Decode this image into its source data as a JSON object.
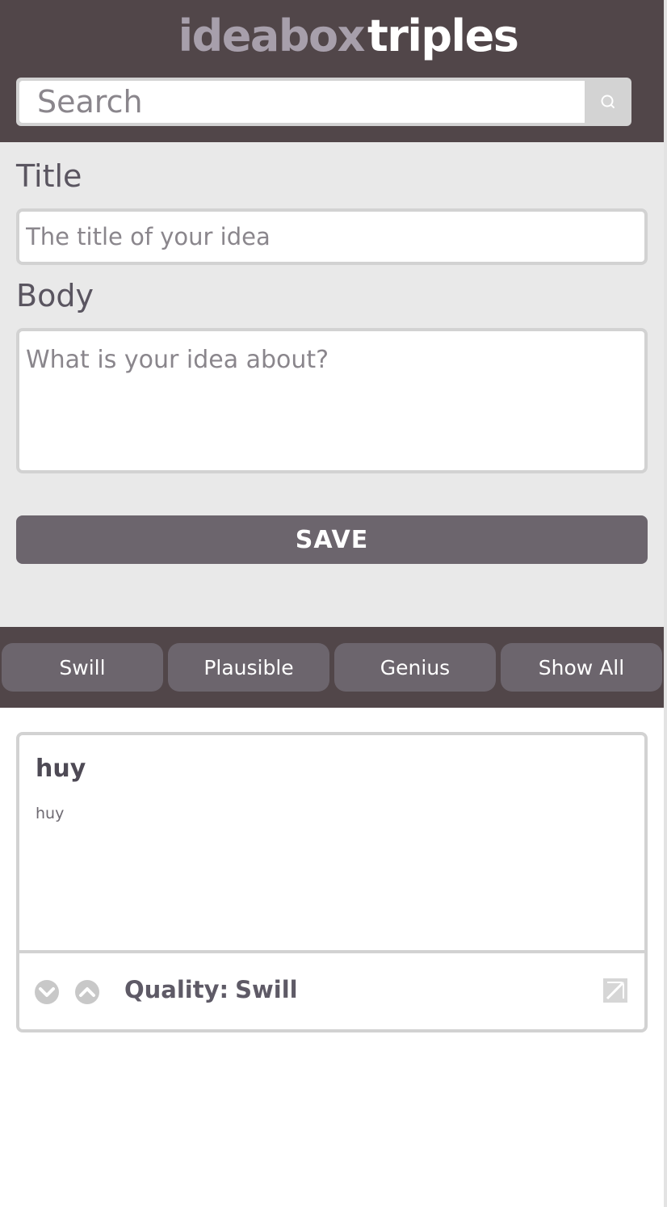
{
  "header": {
    "logo_part1": "ideabox",
    "logo_part2": "triples",
    "search_placeholder": "Search",
    "search_icon": "search-icon"
  },
  "form": {
    "title_label": "Title",
    "title_placeholder": "The title of your idea",
    "body_label": "Body",
    "body_placeholder": "What is your idea about?",
    "save_label": "SAVE"
  },
  "filters": [
    "Swill",
    "Plausible",
    "Genius",
    "Show All"
  ],
  "ideas": [
    {
      "title": "huy",
      "body": "huy",
      "quality_label": "Quality:",
      "quality_value": "Swill",
      "downvote_icon": "chevron-down-circle-icon",
      "upvote_icon": "chevron-up-circle-icon",
      "delete_icon": "delete-icon"
    }
  ],
  "colors": {
    "header_bg": "#514649",
    "logo_accent": "#a79fab",
    "button_bg": "#6c656d",
    "form_bg": "#e9e9e9",
    "border": "#d2d2d2"
  }
}
